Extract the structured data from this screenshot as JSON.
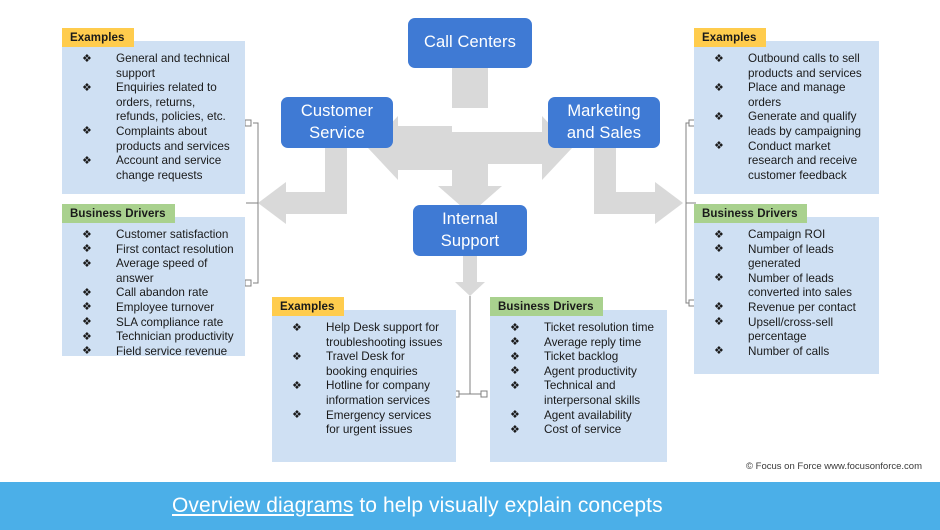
{
  "colors": {
    "node_blue": "#3f7ad4",
    "panel_body_blue": "#cfe0f3",
    "tab_yellow": "#ffcc4d",
    "tab_green": "#a9d18e",
    "arrow_gray": "#d9d9d9",
    "connector_gray": "#7f7f7f",
    "footer_blue": "#4bafe8",
    "text_white": "#ffffff",
    "text_dark": "#1a1a1a"
  },
  "bullet_glyph": "❖",
  "nodes": {
    "call_centers": "Call Centers",
    "customer_service_line1": "Customer",
    "customer_service_line2": "Service",
    "marketing_line1": "Marketing",
    "marketing_line2": "and Sales",
    "internal_support_line1": "Internal",
    "internal_support_line2": "Support"
  },
  "labels": {
    "examples": "Examples",
    "business_drivers": "Business Drivers"
  },
  "panels": {
    "customer_service_examples": {
      "title": "Examples",
      "items": [
        "General and technical support",
        "Enquiries related to orders, returns, refunds, policies, etc.",
        "Complaints about products and services",
        "Account and service change requests"
      ]
    },
    "customer_service_drivers": {
      "title": "Business Drivers",
      "items": [
        "Customer satisfaction",
        "First contact resolution",
        "Average speed of answer",
        "Call abandon rate",
        "Employee turnover",
        "SLA compliance rate",
        "Technician productivity",
        "Field service revenue"
      ]
    },
    "marketing_sales_examples": {
      "title": "Examples",
      "items": [
        "Outbound calls to sell products and services",
        "Place and manage orders",
        "Generate and qualify leads by campaigning",
        "Conduct market research and receive customer feedback"
      ]
    },
    "marketing_sales_drivers": {
      "title": "Business Drivers",
      "items": [
        "Campaign ROI",
        "Number of leads generated",
        "Number of leads converted into sales",
        "Revenue per contact",
        "Upsell/cross-sell percentage",
        "Number of calls"
      ]
    },
    "internal_support_examples": {
      "title": "Examples",
      "items": [
        "Help Desk support for troubleshooting issues",
        "Travel Desk for booking enquiries",
        "Hotline for company information services",
        "Emergency services for urgent issues"
      ]
    },
    "internal_support_drivers": {
      "title": "Business Drivers",
      "items": [
        "Ticket resolution time",
        "Average reply time",
        "Ticket backlog",
        "Agent productivity",
        "Technical and interpersonal skills",
        "Agent availability",
        "Cost of service"
      ]
    }
  },
  "copyright": "© Focus on Force www.focusonforce.com",
  "footer": {
    "underlined": "Overview diagrams",
    "rest": " to help visually explain concepts"
  }
}
